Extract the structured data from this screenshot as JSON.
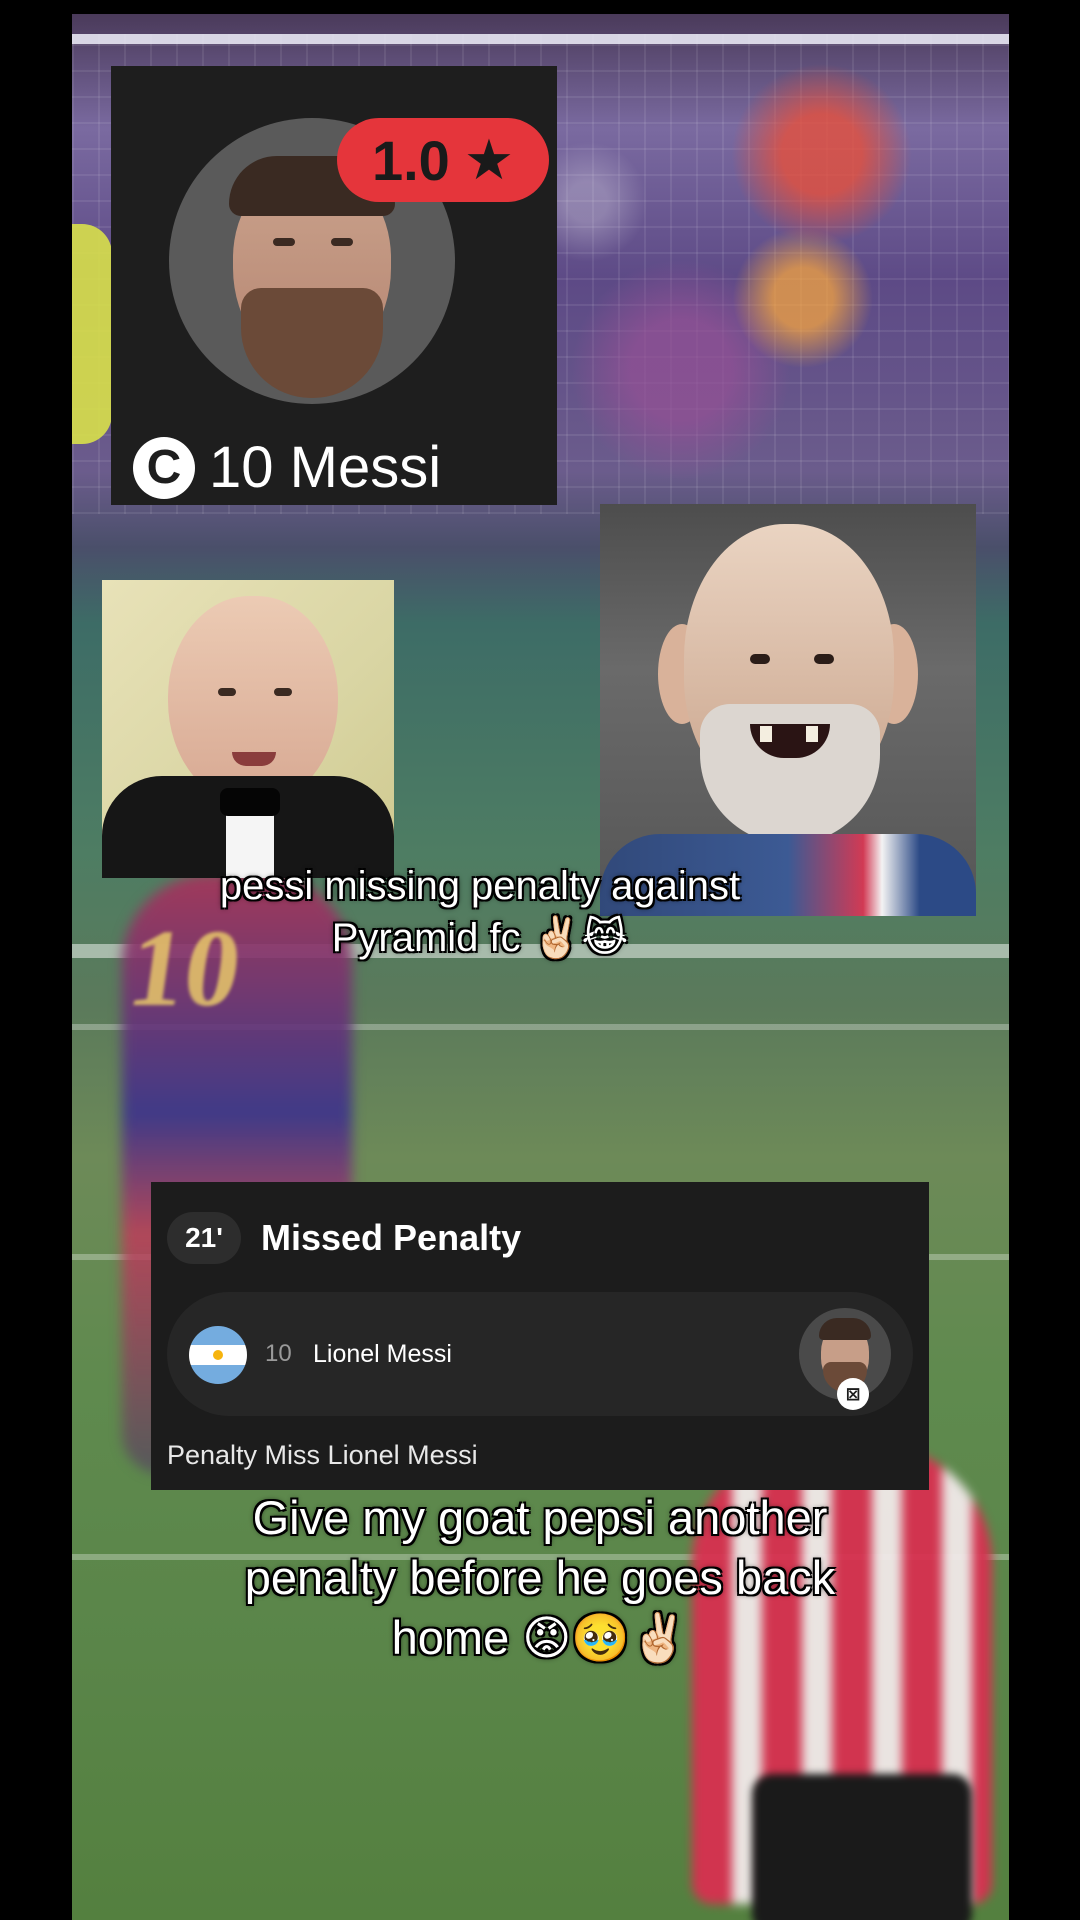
{
  "profile_card": {
    "rating": "1.0",
    "rating_icon": "star-icon",
    "captain_letter": "C",
    "player_label": "10 Messi"
  },
  "caption_top": "pessi missing penalty against Pyramid fc ✌🏻😹",
  "event_card": {
    "minute": "21'",
    "title": "Missed Penalty",
    "player_number": "10",
    "player_name": "Lionel Messi",
    "flag": "argentina-flag-icon",
    "status_icon": "missed-penalty-icon",
    "description": "Penalty Miss Lionel Messi"
  },
  "caption_bottom": "Give my goat pepsi another penalty before he goes back home 😡🥹✌🏻",
  "colors": {
    "rating_badge": "#e5353b",
    "card_bg": "#1c1c1c",
    "row_bg": "#262626"
  }
}
